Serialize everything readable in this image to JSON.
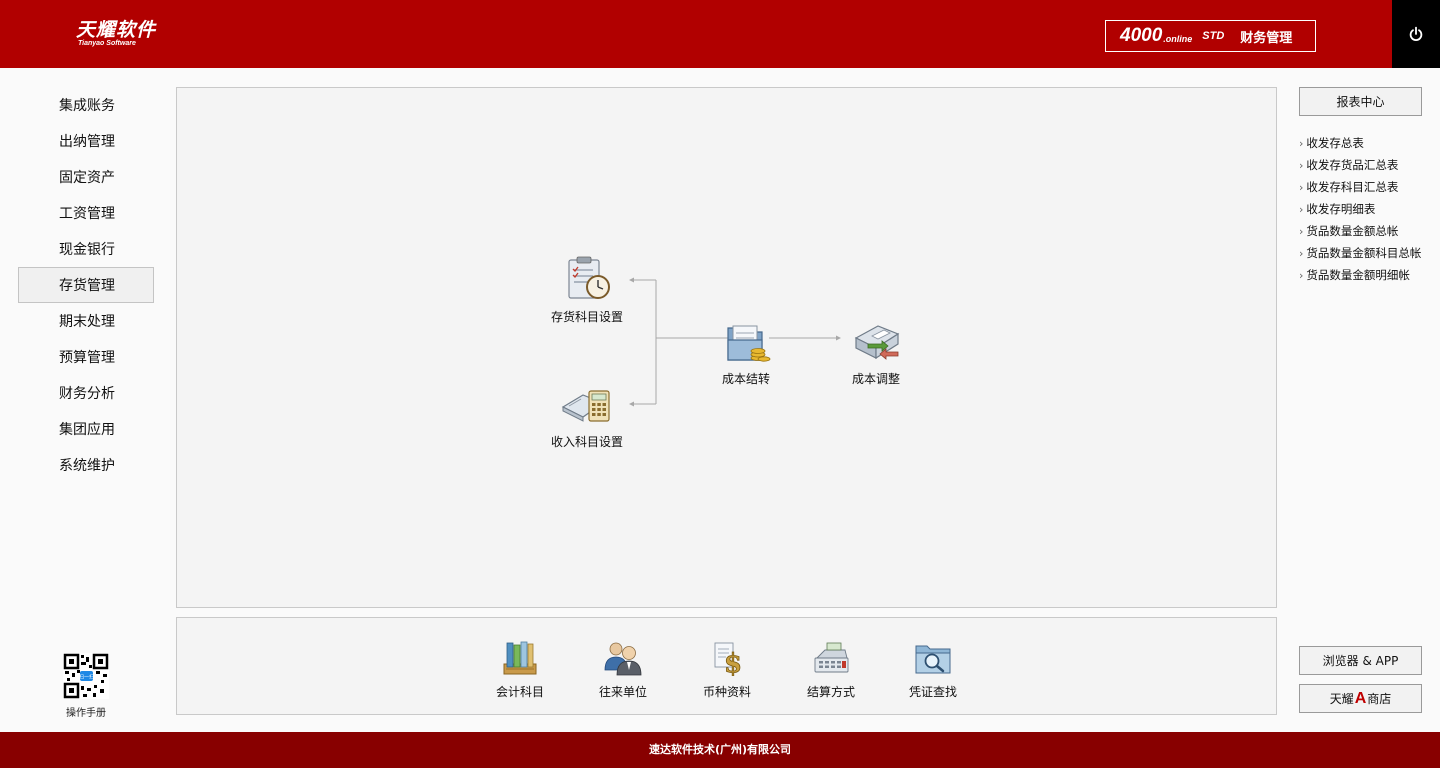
{
  "header": {
    "logo_cn": "天耀软件",
    "logo_en": "Tianyao Software",
    "product_num": "4000",
    "product_online": ".online",
    "product_std": "STD",
    "product_name": "财务管理"
  },
  "nav": {
    "items": [
      {
        "label": "集成账务",
        "active": false
      },
      {
        "label": "出纳管理",
        "active": false
      },
      {
        "label": "固定资产",
        "active": false
      },
      {
        "label": "工资管理",
        "active": false
      },
      {
        "label": "现金银行",
        "active": false
      },
      {
        "label": "存货管理",
        "active": true
      },
      {
        "label": "期末处理",
        "active": false
      },
      {
        "label": "预算管理",
        "active": false
      },
      {
        "label": "财务分析",
        "active": false
      },
      {
        "label": "集团应用",
        "active": false
      },
      {
        "label": "系统维护",
        "active": false
      }
    ],
    "manual_label": "操作手册"
  },
  "flow": {
    "inventory_account_setup": "存货科目设置",
    "income_account_setup": "收入科目设置",
    "cost_carry_forward": "成本结转",
    "cost_adjustment": "成本调整"
  },
  "tools": {
    "accounting_subjects": "会计科目",
    "business_partners": "往来单位",
    "currency_info": "币种资料",
    "settlement_method": "结算方式",
    "voucher_search": "凭证查找"
  },
  "right": {
    "report_center": "报表中心",
    "reports": [
      "收发存总表",
      "收发存货品汇总表",
      "收发存科目汇总表",
      "收发存明细表",
      "货品数量金额总帐",
      "货品数量金额科目总帐",
      "货品数量金额明细帐"
    ],
    "browser_app": "浏览器 & APP",
    "store_prefix": "天耀",
    "store_a": "A",
    "store_suffix": "商店"
  },
  "footer": {
    "company": "速达软件技术(广州)有限公司"
  },
  "colors": {
    "header_red": "#b10000",
    "footer_red": "#880000",
    "power_bg": "#000000"
  }
}
